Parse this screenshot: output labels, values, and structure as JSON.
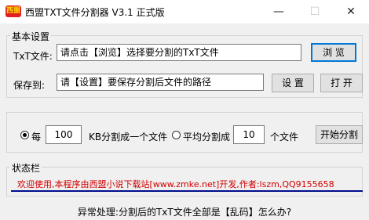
{
  "window": {
    "title": "西盟TXT文件分割器 V3.1 正式版",
    "icon_text": "西盟",
    "minimize_glyph": "—",
    "maximize_glyph": "☐",
    "close_glyph": "✕"
  },
  "basic_settings": {
    "group_label": "基本设置",
    "txt_file_label": "TxT文件:",
    "txt_file_value": "请点击【浏览】选择要分割的TxT文件",
    "browse_label": "浏 览",
    "save_to_label": "保存到:",
    "save_to_value": "请【设置】要保存分割后文件的路径",
    "settings_label": "设 置",
    "open_label": "打 开"
  },
  "split_options": {
    "per_label": "每",
    "per_kb_value": "100",
    "kb_text": "KB分割成一个文件",
    "average_label": "平均分割成",
    "average_count_value": "10",
    "files_text": "个文件",
    "start_label": "开始分割",
    "mode_per_kb_selected": true
  },
  "status": {
    "group_label": "状态栏",
    "message": "欢迎使用,本程序由西盟小说下载站[www.zmke.net]开发,作者:lszm,QQ9155658"
  },
  "footer": {
    "help_text": "异常处理:分割后的TxT文件全部是【乱码】怎么办?"
  },
  "colors": {
    "status_text": "#d00000",
    "status_underline": "#000c8c",
    "focus_border": "#0078d7"
  }
}
